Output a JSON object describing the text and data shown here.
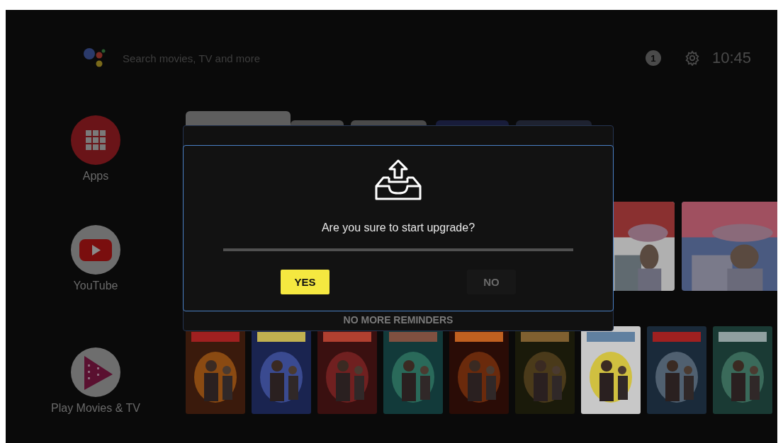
{
  "top_bar": {
    "search": {
      "placeholder": "Search movies, TV and more"
    },
    "notification_count": "1",
    "time": "10:45"
  },
  "apps": [
    {
      "label": "Apps",
      "kind": "apps"
    },
    {
      "label": "YouTube",
      "kind": "youtube"
    },
    {
      "label": "Play Movies & TV",
      "kind": "movies"
    }
  ],
  "background_dialog": {
    "button": "NO MORE REMINDERS"
  },
  "dialog": {
    "message": "Are you sure to start upgrade?",
    "buttons": [
      {
        "label": "YES",
        "selected": true
      },
      {
        "label": "NO",
        "selected": false
      }
    ]
  }
}
